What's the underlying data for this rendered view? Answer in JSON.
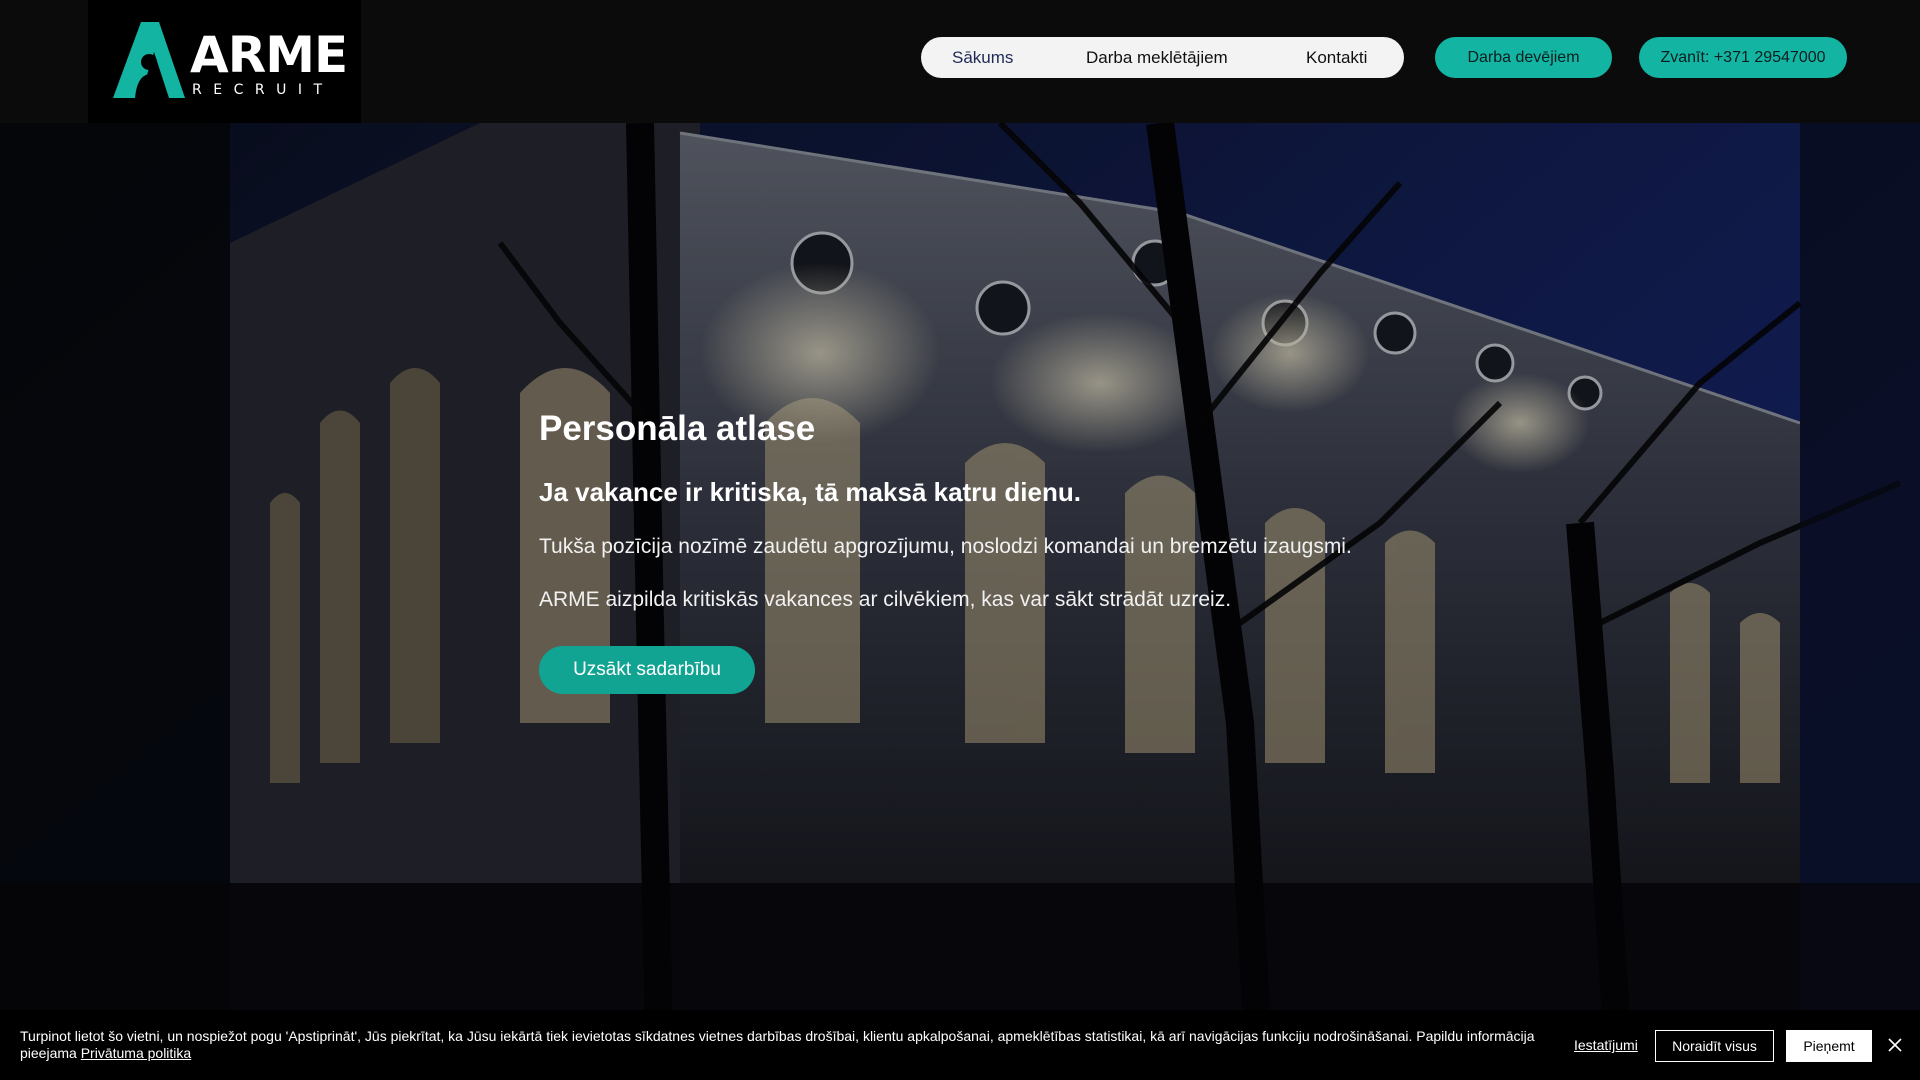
{
  "brand": {
    "name": "ARME",
    "tagline": "RECRUIT",
    "accent": "#13b5a2"
  },
  "nav": {
    "items": [
      {
        "label": "Sākums",
        "active": true
      },
      {
        "label": "Darba meklētājiem",
        "active": false
      },
      {
        "label": "Kontakti",
        "active": false
      }
    ],
    "employers_label": "Darba devējiem",
    "call_label": "Zvanīt: +371 29547000"
  },
  "hero": {
    "title": "Personāla atlase",
    "subtitle": "Ja vakance ir kritiska, tā maksā katru dienu.",
    "paragraph1": "Tukša pozīcija nozīmē zaudētu apgrozījumu, noslodzi komandai un bremzētu izaugsmi.",
    "paragraph2": "ARME aizpilda kritiskās vakances ar cilvēkiem, kas var sākt strādāt uzreiz.",
    "cta_label": "Uzsākt sadarbību"
  },
  "cookie": {
    "text": "Turpinot lietot šo vietni, un nospiežot pogu 'Apstiprināt', Jūs piekrītat, ka Jūsu iekārtā tiek ievietotas sīkdatnes vietnes darbības drošībai, klientu apkalpošanai, apmeklētības statistikai, kā arī navigācijas funkciju nodrošināšanai. Papildu informācija pieejama",
    "privacy_link": "Privātuma politika",
    "settings_label": "Iestatījumi",
    "reject_label": "Noraidīt visus",
    "accept_label": "Pieņemt",
    "close_icon": "close-icon"
  }
}
